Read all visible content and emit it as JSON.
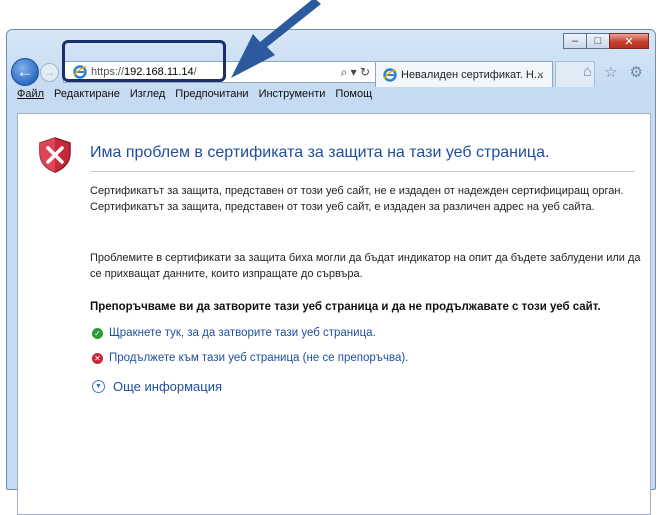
{
  "address_bar": {
    "url_prefix": "https://",
    "url_host": "192.168.11.14",
    "url_suffix": "/",
    "tools": "⌕ ▾ ↻"
  },
  "tab": {
    "title": "Невалиден сертификат. Н...",
    "close": "×"
  },
  "window_controls": {
    "minimize": "–",
    "maximize": "□",
    "close": "✕"
  },
  "right_icons": {
    "home": "⌂",
    "favorites": "☆",
    "settings": "⚙"
  },
  "menu": {
    "file": "Файл",
    "edit": "Редактиране",
    "view": "Изглед",
    "favorites": "Предпочитани",
    "tools": "Инструменти",
    "help": "Помощ"
  },
  "content": {
    "heading": "Има проблем в сертификата за защита на тази уеб страница.",
    "paragraph1_line1": "Сертификатът за защита, представен от този уеб сайт, не е издаден от надежден сертифициращ орган.",
    "paragraph1_line2": "Сертификатът за защита, представен от този уеб сайт, е издаден за различен адрес на уеб сайта.",
    "paragraph2": "Проблемите в сертификати за защита биха могли да бъдат индикатор на опит да бъдете заблудени или да се прихващат данните, които изпращате до сървъра.",
    "recommendation": "Препоръчваме ви да затворите тази уеб страница и да не продължавате с този уеб сайт.",
    "close_link": "Щракнете тук, за да затворите тази уеб страница.",
    "continue_link": "Продължете към тази уеб страница (не се препоръчва).",
    "more_info": "Още информация"
  },
  "colors": {
    "link": "#1f4e9f",
    "arrow": "#2d5a9e",
    "highlight": "#1a2f6a"
  }
}
